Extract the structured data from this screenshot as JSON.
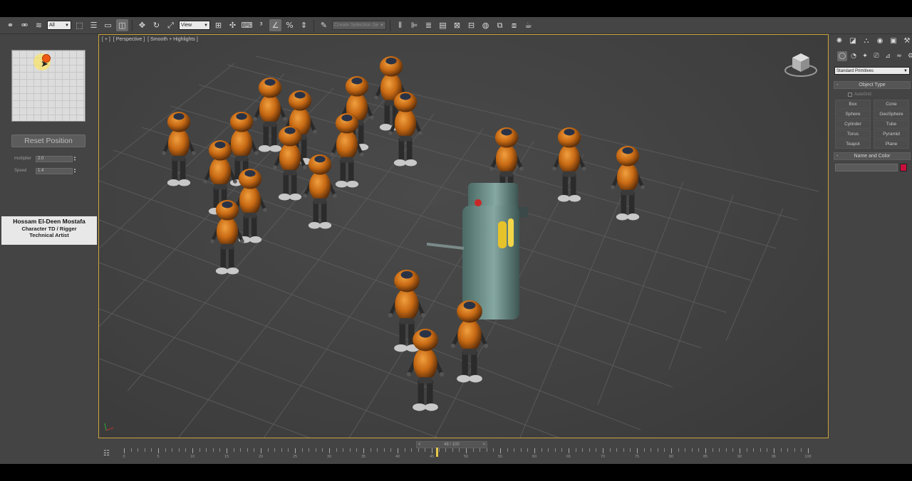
{
  "toolbar": {
    "selection_filter": "All",
    "ref_coord": "View",
    "named_selection": "Create Selection Se"
  },
  "rig_panel": {
    "reset_label": "Reset Position",
    "multiplier_label": "multiplier",
    "multiplier_value": "2.0",
    "speed_label": "Speed",
    "speed_value": "1.4",
    "credit_name": "Hossam El-Deen Mostafa",
    "credit_role_1": "Character TD / Rigger",
    "credit_role_2": "Technical Artist"
  },
  "viewport": {
    "label_plus": "[ + ]",
    "label_view": "[ Perspective ]",
    "label_shading": "[ Smooth + Highlights ]"
  },
  "command_panel": {
    "category": "Standard Primitives",
    "object_type_title": "Object Type",
    "autogrid_label": "AutoGrid",
    "primitives": [
      "Box",
      "Cone",
      "Sphere",
      "GeoSphere",
      "Cylinder",
      "Tube",
      "Torus",
      "Pyramid",
      "Teapot",
      "Plane"
    ],
    "name_color_title": "Name and Color",
    "color": "#c8103c"
  },
  "timeline": {
    "slider_label": "48 / 100",
    "ticks": [
      "0",
      "5",
      "10",
      "15",
      "20",
      "25",
      "30",
      "35",
      "40",
      "45",
      "50",
      "55",
      "60",
      "65",
      "70",
      "75",
      "80",
      "85",
      "90",
      "95",
      "100"
    ]
  },
  "colors": {
    "robot_orange": "#c86a14",
    "viewport_border": "#c9a43b"
  }
}
